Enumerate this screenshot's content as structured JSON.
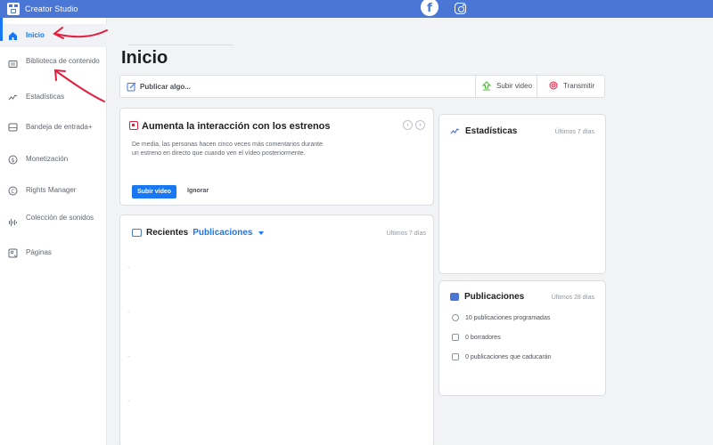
{
  "app": {
    "title": "Creator Studio"
  },
  "topbar": {
    "platforms": [
      "facebook-icon",
      "instagram-icon"
    ]
  },
  "sidebar": {
    "items": [
      {
        "label": "Inicio",
        "icon": "home-icon",
        "active": true
      },
      {
        "label": "Biblioteca de contenido",
        "icon": "library-icon"
      },
      {
        "label": "Estadísticas",
        "icon": "insights-icon"
      },
      {
        "label": "Bandeja de entrada+",
        "icon": "inbox-icon"
      },
      {
        "label": "Monetización",
        "icon": "dollar-icon"
      },
      {
        "label": "Rights Manager",
        "icon": "copyright-icon"
      },
      {
        "label": "Colección de sonidos",
        "icon": "sound-icon"
      },
      {
        "label": "Páginas",
        "icon": "pages-icon"
      }
    ]
  },
  "main": {
    "title": "Inicio",
    "composer": {
      "placeholder": "Publicar algo...",
      "upload_label": "Subir video",
      "live_label": "Transmitir"
    },
    "premiere_card": {
      "title": "Aumenta la interacción con los estrenos",
      "body": "De media, las personas hacen cinco veces más comentarios durante un estreno en directo que cuando ven el vídeo posteriormente.",
      "primary_button": "Subir vídeo",
      "secondary_button": "Ignorar"
    },
    "recent_card": {
      "title": "Recientes",
      "dropdown": "Publicaciones",
      "period": "Últimos 7 días"
    },
    "stats_card": {
      "title": "Estadísticas",
      "period": "Últimos 7 días"
    },
    "posts_card": {
      "title": "Publicaciones",
      "period": "Últimos 28 días",
      "rows": [
        {
          "text": "10 publicaciones programadas",
          "icon": "clock-icon"
        },
        {
          "text": "0 borradores",
          "icon": "draft-icon"
        },
        {
          "text": "0 publicaciones que caducarán",
          "icon": "expire-icon"
        }
      ]
    }
  },
  "colors": {
    "brand": "#4a76d6",
    "accent": "#1877f2",
    "annotation": "#e41e3f"
  }
}
